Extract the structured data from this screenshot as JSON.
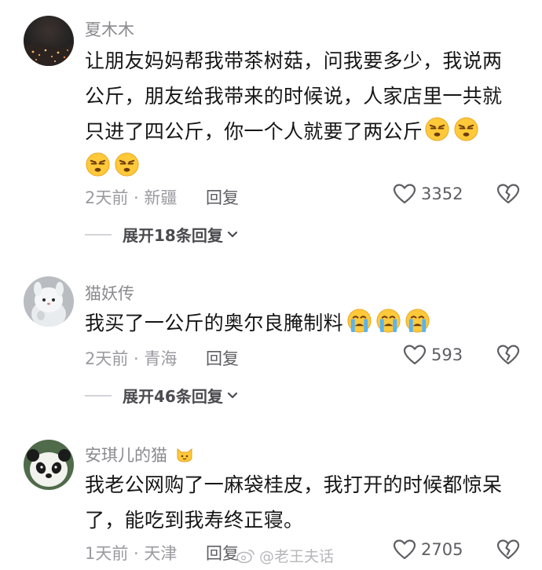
{
  "comments": [
    {
      "username": "夏木木",
      "text_lines": [
        "让朋友妈妈帮我带茶树菇，问我要多少，我说两",
        "公斤，朋友给我带来的时候说，人家店里一共就",
        "只进了四公斤，你一个人就要了两公斤"
      ],
      "emoji_name": "speechless-face-emoji",
      "meta": "2天前 · 新疆",
      "reply_label": "回复",
      "likes": "3352",
      "expand_label": "展开18条回复"
    },
    {
      "username": "猫妖传",
      "text_lines": [
        "我买了一公斤的奥尔良腌制料"
      ],
      "emoji_name": "crying-face-emoji",
      "meta": "2天前 · 青海",
      "reply_label": "回复",
      "likes": "593",
      "expand_label": "展开46条回复"
    },
    {
      "username": "安琪儿的猫",
      "username_badge": "cat-face-emoji",
      "text_lines": [
        "我老公网购了一麻袋桂皮，我打开的时候都惊呆",
        "了，能吃到我寿终正寝。"
      ],
      "meta": "1天前 · 天津",
      "reply_label": "回复",
      "likes": "2705"
    }
  ],
  "watermark": "@老王夫话",
  "colors": {
    "text": "#161616",
    "secondary": "#8a8a8f",
    "emoji_yellow": "#ffc93a",
    "tear_blue": "#5ab3f0"
  }
}
